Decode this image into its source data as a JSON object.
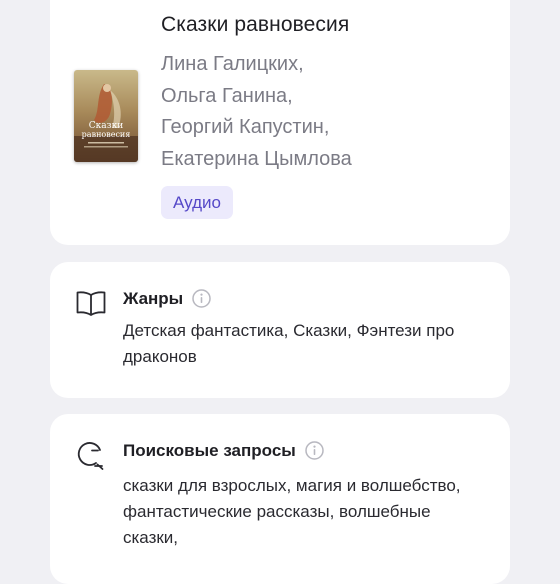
{
  "book": {
    "title": "Сказки равновесия",
    "authors": [
      "Лина Галицких,",
      "Ольга Ганина,",
      "Георгий Капустин,",
      "Екатерина Цымлова"
    ],
    "format_badge": "Аудио",
    "cover": {
      "title_line1": "Сказки",
      "title_line2": "равновесия",
      "icon": "book-cover-image"
    }
  },
  "genres": {
    "title": "Жанры",
    "icon": "open-book-icon",
    "text": "Детская фантастика, Сказки, Фэнтези про драконов"
  },
  "search_queries": {
    "title": "Поисковые запросы",
    "icon": "search-icon",
    "text": "сказки для взрослых, магия и волшебство, фантастические рассказы, волшебные сказки,"
  },
  "colors": {
    "background": "#f0f0f4",
    "card": "#ffffff",
    "badge_bg": "#eceafc",
    "badge_text": "#5548c8",
    "muted_text": "#7b7b85"
  }
}
